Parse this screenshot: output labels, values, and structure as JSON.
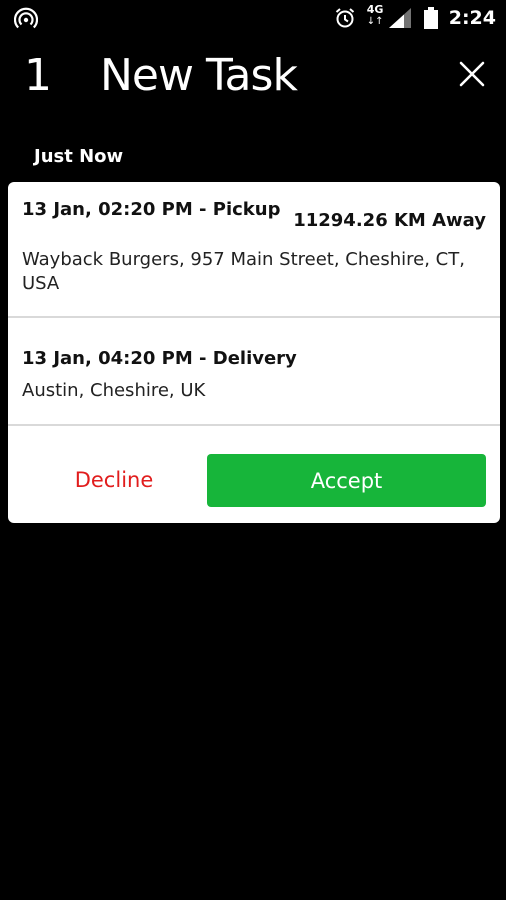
{
  "status_bar": {
    "network": "4G",
    "network_arrows": "↓↑",
    "time": "2:24",
    "icons": [
      "hotspot-icon",
      "alarm-icon",
      "signal-icon",
      "battery-icon"
    ]
  },
  "header": {
    "task_count": "1",
    "title": "New Task",
    "close_icon": "close-icon"
  },
  "section_label": "Just Now",
  "task": {
    "pickup": {
      "time": "13 Jan, 02:20 PM - Pickup",
      "address": "Wayback Burgers, 957 Main Street, Cheshire, CT, USA"
    },
    "distance": "11294.26 KM Away",
    "delivery": {
      "time": "13 Jan, 04:20 PM - Delivery",
      "address": "Austin, Cheshire, UK"
    },
    "actions": {
      "decline_label": "Decline",
      "accept_label": "Accept"
    }
  },
  "colors": {
    "background": "#000000",
    "card": "#ffffff",
    "accept": "#17b53a",
    "decline": "#e11d1d"
  }
}
